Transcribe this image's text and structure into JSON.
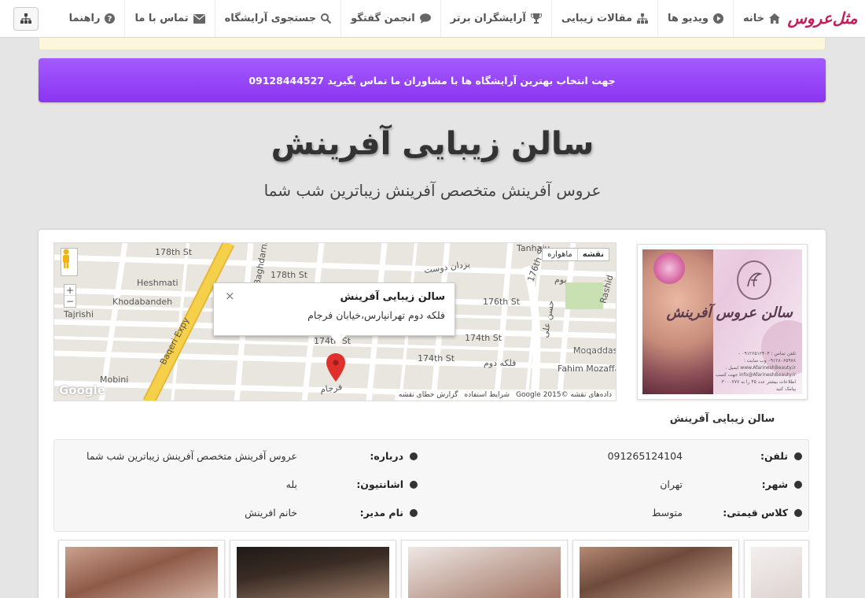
{
  "nav": {
    "brand": "مثل‌عروس",
    "items": [
      {
        "label": "خانه",
        "icon": "home-icon"
      },
      {
        "label": "ویدیو ها",
        "icon": "play-icon"
      },
      {
        "label": "مقالات زیبایی",
        "icon": "sitemap-icon"
      },
      {
        "label": "آرایشگران برتر",
        "icon": "trophy-icon"
      },
      {
        "label": "انجمن گفتگو",
        "icon": "comment-icon"
      },
      {
        "label": "جستجوی آرایشگاه",
        "icon": "search-icon"
      },
      {
        "label": "تماس با ما",
        "icon": "envelope-icon"
      },
      {
        "label": "راهنما",
        "icon": "question-icon"
      }
    ]
  },
  "banner": {
    "text": "جهت انتخاب بهترین آرایشگاه ها با مشاوران ما تماس بگیرید 09128444527"
  },
  "header": {
    "title": "سالن زیبایی آفرینش",
    "subtitle": "عروس آفرینش متخصص آفرینش زیباترین شب شما"
  },
  "map": {
    "type_buttons": [
      "نقشه",
      "ماهواره"
    ],
    "infowindow_title": "سالن زیبایی آفرینش",
    "infowindow_address": "فلکه دوم تهرانپارس،خیابان فرجام",
    "close_symbol": "×",
    "zoom_in": "+",
    "zoom_out": "−",
    "google": "Google",
    "footer": [
      "داده‌های نقشه ©2015 Google",
      "شرایط استفاده",
      "گزارش خطای نقشه"
    ],
    "streets": [
      "178th St",
      "178th St",
      "Heshmati",
      "Khodabandeh",
      "Tajrishi",
      "Baqeri Expy",
      "Mobini",
      "Baghdarniy",
      "176th St",
      "174th St",
      "174th St",
      "174th St",
      "176th St",
      "Tanhaju",
      "Moqaddas",
      "Fahim Mozaffa",
      "Rashid",
      "یزدان دوست",
      "فلکه دوم",
      "بوم",
      "فرجام",
      "حسن علی"
    ]
  },
  "logo": {
    "name": "سالن عروس آفرینش",
    "details": "تلفن تماس : ۰۹۱۲۶۵۱۲۴۰۴ - ۰۹۱۲۸۰۶۵۹۷۸ وب سایت : www.AfarineshBeauty.ir ایمیل : info@AfarineshBeauty.ir جهت کسب اطلاعات بیشتر عدد ۴۵ را به ۳۰۰۰۷۷۷ پیامک کنید"
  },
  "caption": "سالن زیبایی آفرینش",
  "info": {
    "phone_label": "تلفن:",
    "phone_value": "091265124104",
    "city_label": "شهر:",
    "city_value": "تهران",
    "price_label": "کلاس قیمتی:",
    "price_value": "متوسط",
    "about_label": "درباره:",
    "about_value": "عروس آفرینش متخصص آفرینش زیباترین شب شما",
    "shinion_label": "اشانتیون:",
    "shinion_value": "بله",
    "manager_label": "نام مدیر:",
    "manager_value": "خانم افرینش"
  },
  "colors": {
    "banner_top": "#a45bff",
    "banner_bottom": "#8a34f0",
    "brand": "#c21d58",
    "pin": "#e0302b",
    "road_yellow": "#f5d04a"
  }
}
